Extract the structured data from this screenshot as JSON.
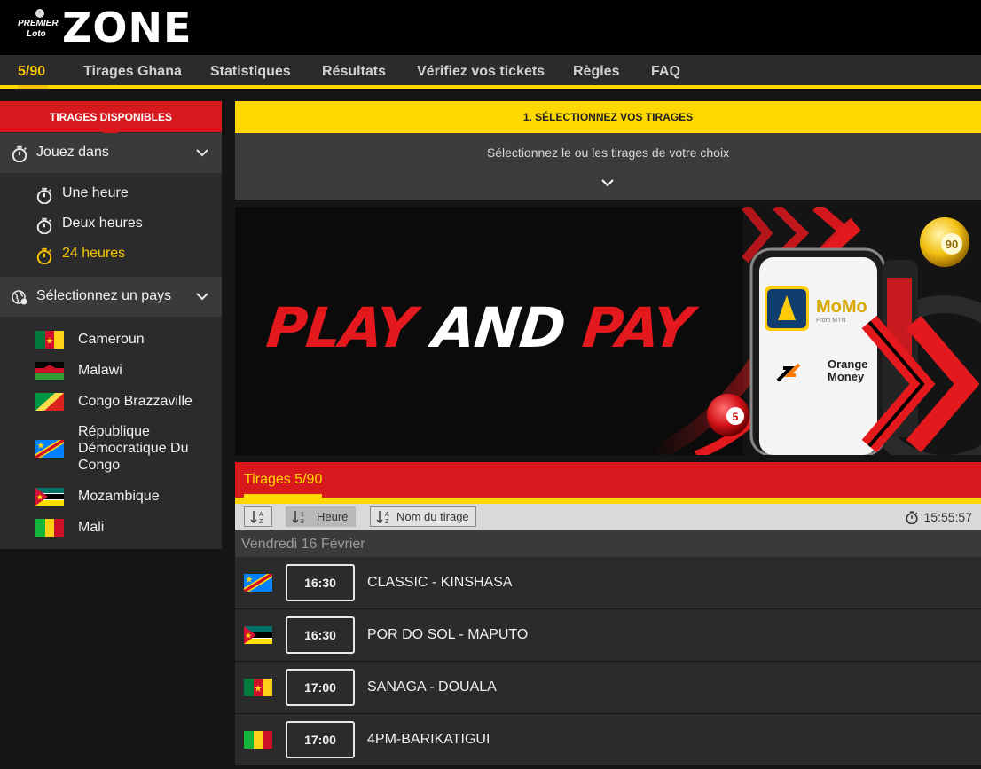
{
  "header": {
    "logo": {
      "premier": "PREMIER",
      "loto": "Loto",
      "zone": "ZONE"
    }
  },
  "nav": {
    "items": [
      {
        "label": "5/90",
        "active": true
      },
      {
        "label": "Tirages Ghana"
      },
      {
        "label": "Statistiques"
      },
      {
        "label": "Résultats"
      },
      {
        "label": "Vérifiez vos tickets"
      },
      {
        "label": "Règles"
      },
      {
        "label": "FAQ"
      }
    ]
  },
  "sidebar": {
    "title": "TIRAGES DISPONIBLES",
    "play_section": {
      "label": "Jouez dans",
      "icon": "stopwatch-icon"
    },
    "time_options": [
      {
        "label": "Une heure"
      },
      {
        "label": "Deux heures"
      },
      {
        "label": "24 heures",
        "active": true
      }
    ],
    "country_section": {
      "label": "Sélectionnez un pays",
      "icon": "globe-icon"
    },
    "countries": [
      {
        "label": "Cameroun"
      },
      {
        "label": "Malawi"
      },
      {
        "label": "Congo Brazzaville"
      },
      {
        "label": "République Démocratique Du Congo"
      },
      {
        "label": "Mozambique"
      },
      {
        "label": "Mali"
      }
    ]
  },
  "step": {
    "title": "1. SÉLECTIONNEZ VOS TIRAGES",
    "subtitle": "Sélectionnez le ou les tirages de votre choix"
  },
  "banner": {
    "play": "PLAY",
    "and": "AND",
    "pay": "PAY",
    "momo": "MoMo",
    "momo_sub": "From MTN",
    "orange": "Orange",
    "money": "Money",
    "ball_90": "90",
    "ball_5": "5"
  },
  "draws": {
    "title": "Tirages 5/90",
    "sort": {
      "az_label": "",
      "hour_label": "Heure",
      "name_label": "Nom du tirage"
    },
    "clock": "15:55:57",
    "date": "Vendredi 16 Février",
    "rows": [
      {
        "time": "16:30",
        "name": "CLASSIC - KINSHASA",
        "country": "drc"
      },
      {
        "time": "16:30",
        "name": "POR DO SOL - MAPUTO",
        "country": "mozambique"
      },
      {
        "time": "17:00",
        "name": "SANAGA - DOUALA",
        "country": "cameroon"
      },
      {
        "time": "17:00",
        "name": "4PM-BARIKATIGUI",
        "country": "mali"
      }
    ]
  },
  "colors": {
    "accent_yellow": "#ffd800",
    "accent_red": "#d7191d",
    "active_text": "#f5c400"
  }
}
